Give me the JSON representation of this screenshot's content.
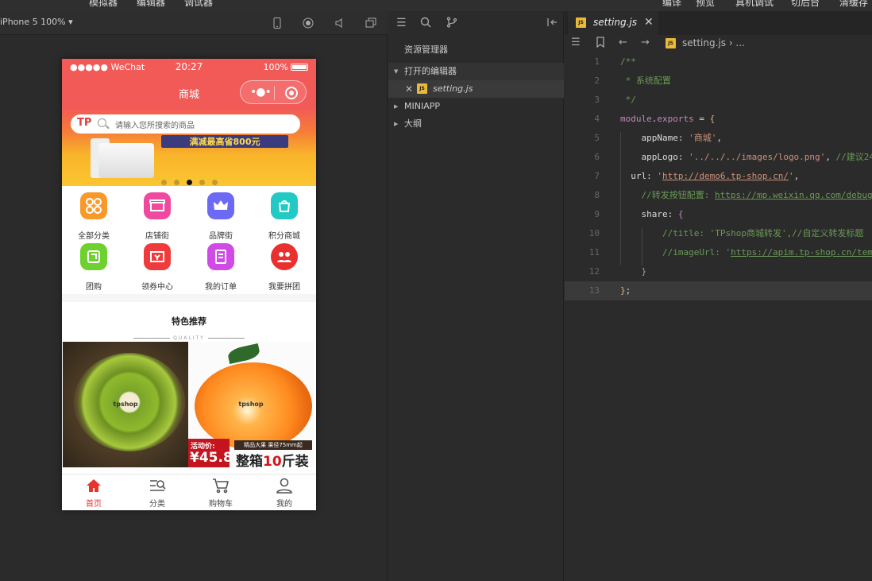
{
  "menubar": {
    "items": [
      "模拟器",
      "编辑器",
      "调试器",
      "编译",
      "预览",
      "真机调试",
      "切后台",
      "清缓存"
    ]
  },
  "simulator": {
    "device": "iPhone 5 100% ▾",
    "statusbar": {
      "signal": "●●●●● WeChat",
      "time": "20:27",
      "battery": "100%"
    },
    "nav_title": "商城",
    "search": {
      "logo": "TP",
      "placeholder": "请输入您所搜索的商品"
    },
    "banner": {
      "promo": "满减最高省800元",
      "active_dot": 3
    },
    "categories": [
      {
        "label": "全部分类",
        "icon": "grid-icon",
        "color": "#f89a2b"
      },
      {
        "label": "店铺街",
        "icon": "shop-icon",
        "color": "#f04aa0"
      },
      {
        "label": "品牌街",
        "icon": "crown-icon",
        "color": "#6c6af5"
      },
      {
        "label": "积分商城",
        "icon": "bag-icon",
        "color": "#23c9c4"
      },
      {
        "label": "团购",
        "icon": "group-icon",
        "color": "#6fd12f"
      },
      {
        "label": "领券中心",
        "icon": "coupon-icon",
        "color": "#ef3b3b"
      },
      {
        "label": "我的订单",
        "icon": "order-icon",
        "color": "#d04be6"
      },
      {
        "label": "我要拼团",
        "icon": "pin-group-icon",
        "color": "#ea2f2f"
      }
    ],
    "feature": {
      "title": "特色推荐",
      "subtitle": "QUALITY"
    },
    "products": [
      {
        "watermark": "tpshop"
      },
      {
        "watermark": "tpshop",
        "tag_label": "活动价:",
        "price": "¥45.8",
        "dark_tag": "精品大果 果径75mm起",
        "big": "整箱",
        "big_num": "10",
        "big_unit": "斤装"
      }
    ],
    "tabs": [
      {
        "label": "首页",
        "icon": "home-icon",
        "active": true
      },
      {
        "label": "分类",
        "icon": "category-icon",
        "active": false
      },
      {
        "label": "购物车",
        "icon": "cart-icon",
        "active": false
      },
      {
        "label": "我的",
        "icon": "user-icon",
        "active": false
      }
    ]
  },
  "explorer": {
    "title": "资源管理器",
    "open_editors": "打开的编辑器",
    "open_file": "setting.js",
    "miniapp": "MINIAPP",
    "outline": "大纲"
  },
  "editor": {
    "tab_file": "setting.js",
    "breadcrumb": "setting.js › ...",
    "js_badge": "JS",
    "lines": [
      "1",
      "2",
      "3",
      "4",
      "5",
      "6",
      "7",
      "8",
      "9",
      "10",
      "11",
      "12",
      "13"
    ]
  }
}
